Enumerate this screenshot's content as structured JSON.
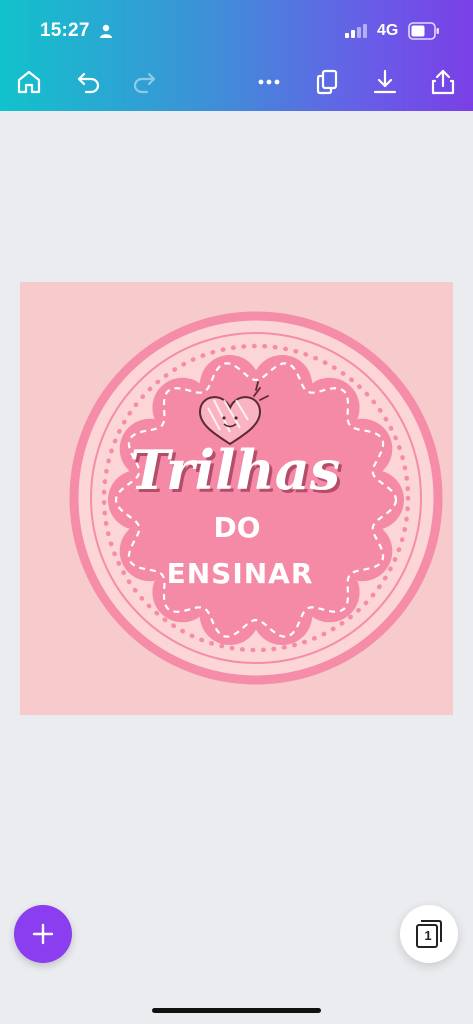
{
  "status_bar": {
    "time": "15:27",
    "network": "4G"
  },
  "toolbar": {
    "icons": [
      "home-icon",
      "undo-icon",
      "redo-icon",
      "more-icon",
      "duplicate-icon",
      "download-icon",
      "share-icon"
    ]
  },
  "design": {
    "line1": "Trilhas",
    "line2": "DO",
    "line3": "ENSINAR",
    "colors": {
      "background": "#f7cacb",
      "ring": "#f58ca8",
      "badge": "#f48aa6",
      "text": "#ffffff"
    }
  },
  "pages_button": {
    "count": "1"
  },
  "colors": {
    "accent": "#8b3df0",
    "canvas_bg": "#ebecef"
  }
}
